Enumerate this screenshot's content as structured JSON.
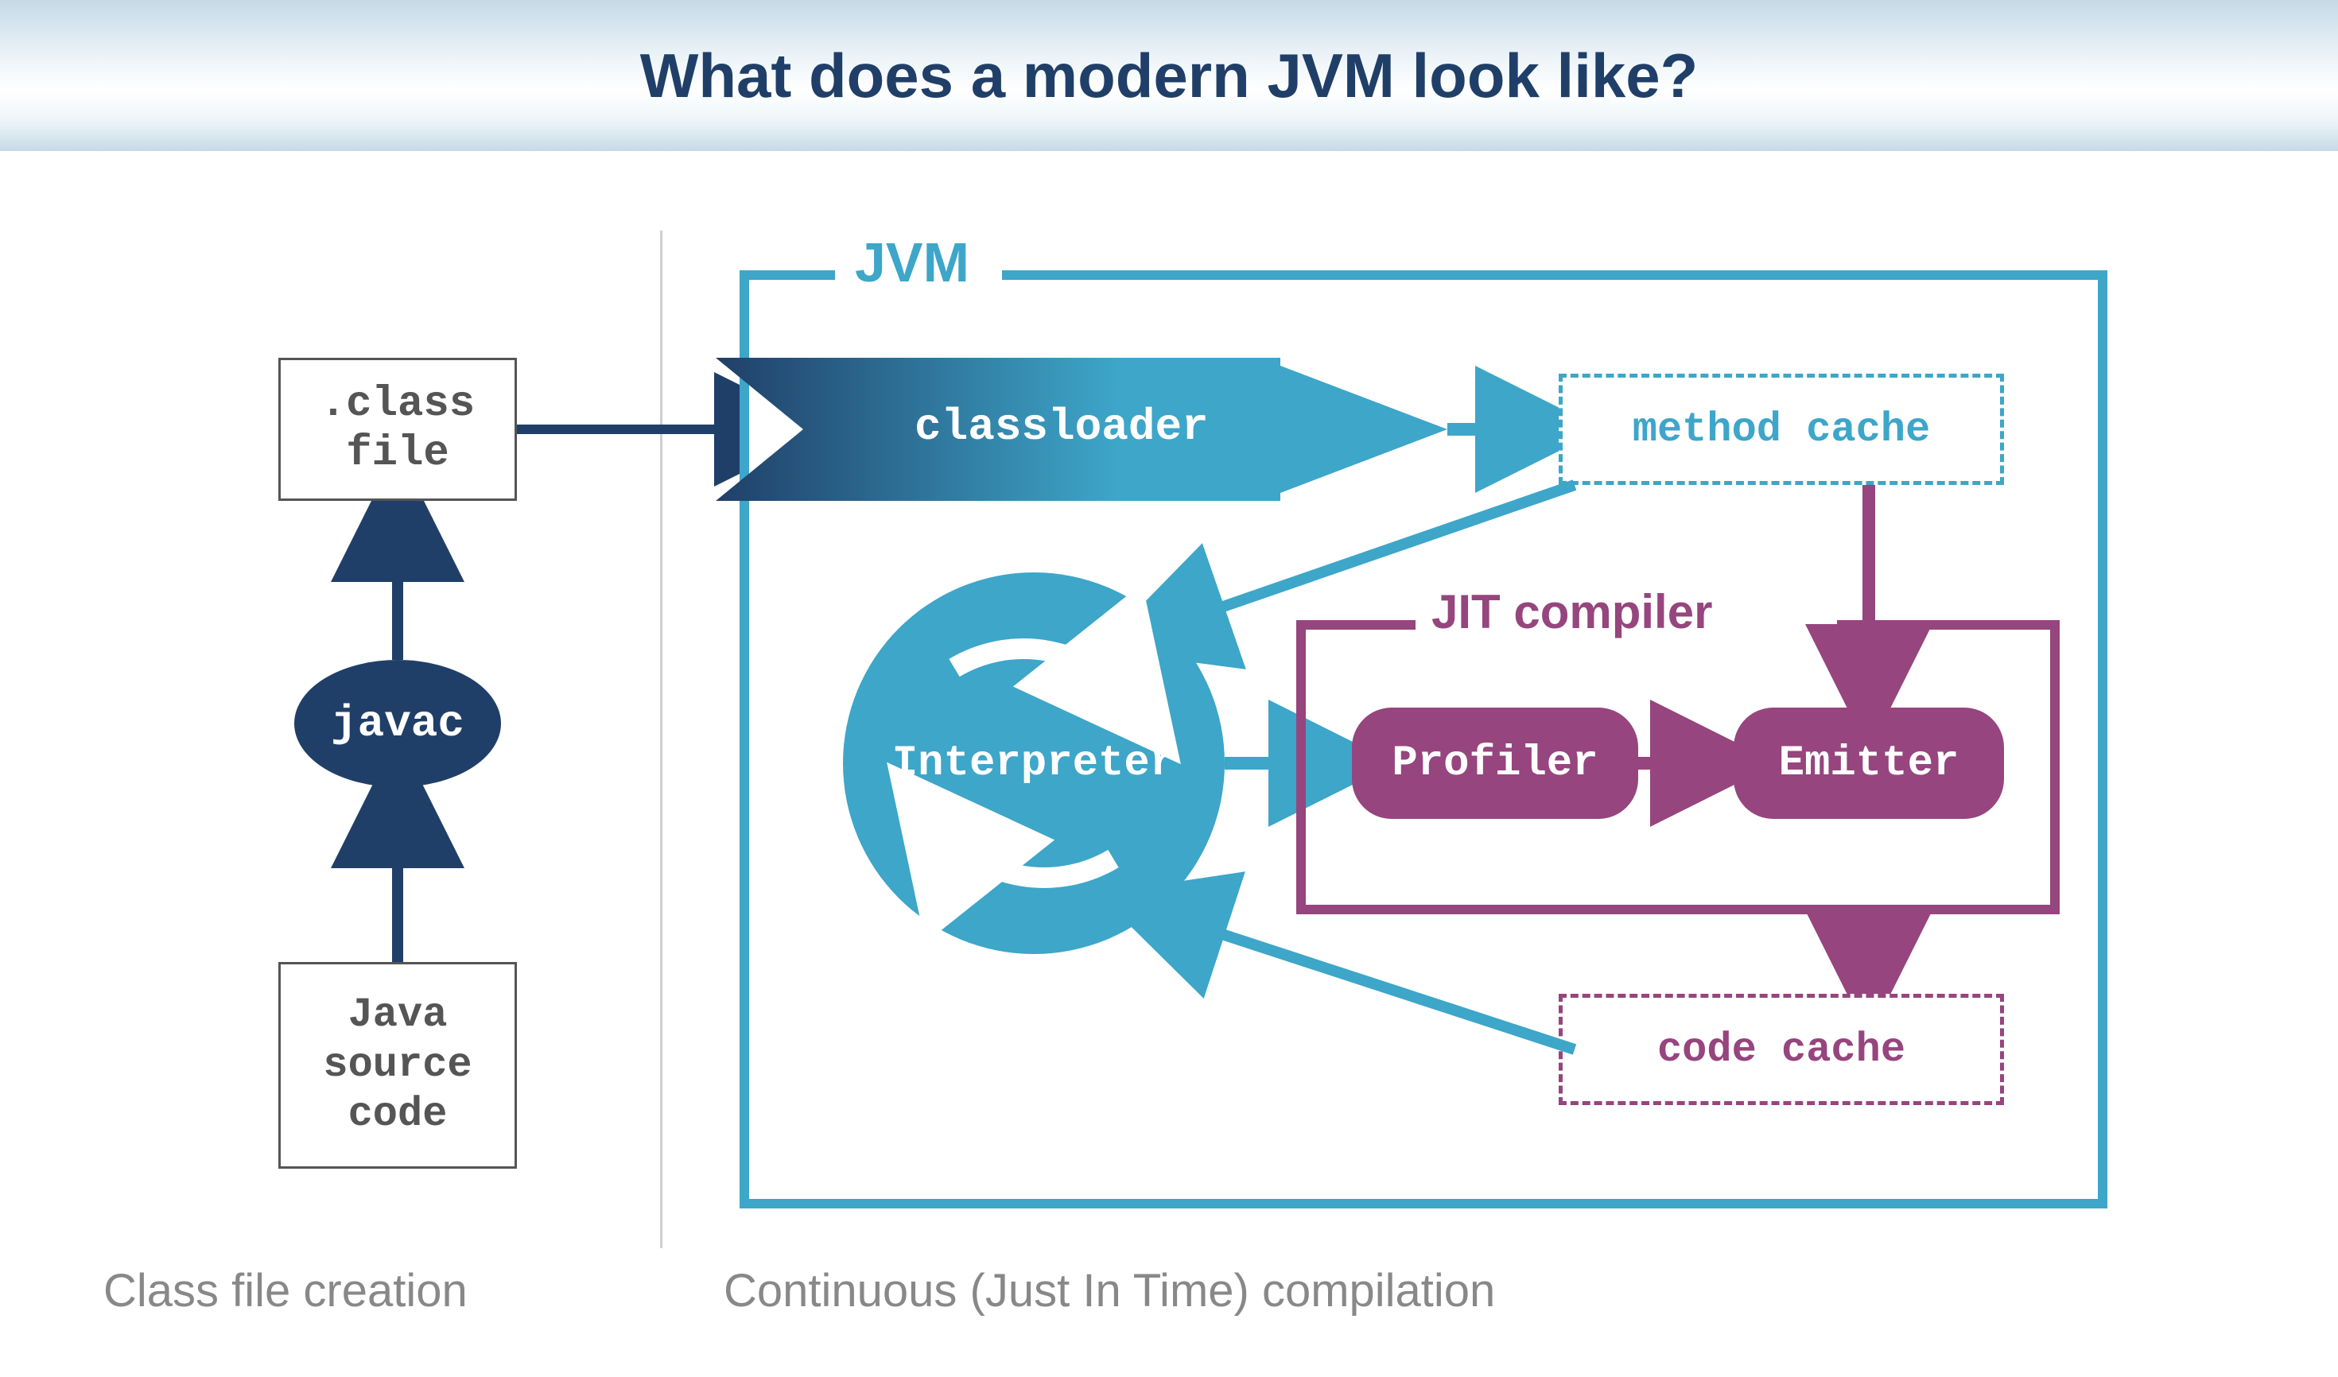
{
  "title": "What does a modern JVM look like?",
  "left_column": {
    "class_file": ".class\nfile",
    "javac": "javac",
    "java_source": "Java\nsource\ncode",
    "caption": "Class file creation"
  },
  "jvm": {
    "label": "JVM",
    "classloader": "classloader",
    "method_cache": "method cache",
    "interpreter": "Interpreter",
    "jit_label": "JIT compiler",
    "profiler": "Profiler",
    "emitter": "Emitter",
    "code_cache": "code cache",
    "caption": "Continuous (Just In Time) compilation"
  },
  "colors": {
    "navy": "#203F68",
    "teal": "#3DA6C9",
    "magenta": "#96457E",
    "grey": "#888"
  }
}
